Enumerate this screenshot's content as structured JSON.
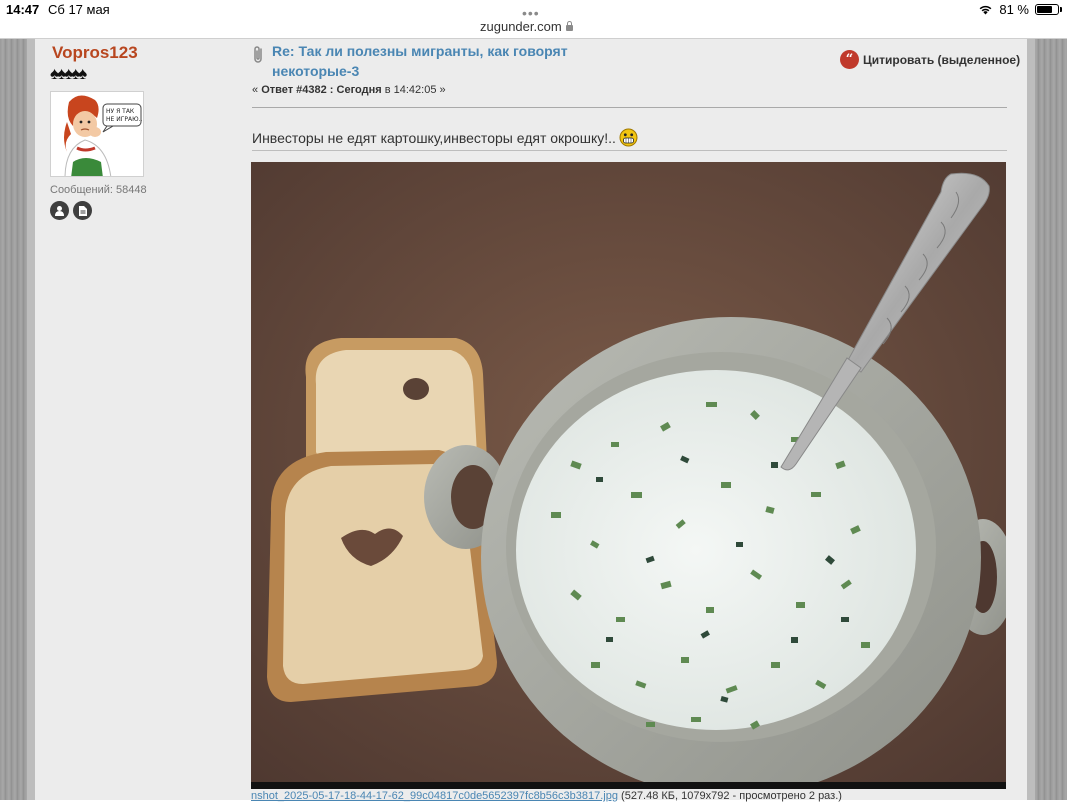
{
  "status_bar": {
    "time": "14:47",
    "date": "Сб 17 мая",
    "battery_percent": "81 %",
    "battery_level": 0.81
  },
  "browser": {
    "url": "zugunder.com"
  },
  "poster": {
    "username": "Vopros123",
    "rank_stars": "♠♠♠♠♠",
    "avatar_text": "НУ Я ТАК НЕ ИГРАЮ...",
    "posts_count": "Сообщений: 58448"
  },
  "post": {
    "title": "Re: Так ли полезны мигранты, как говорят некоторые-3",
    "meta_prefix": "« ",
    "reply_label": "Ответ #4382 : Сегодня",
    "meta_time": " в 14:42:05 »",
    "quote_label": "Цитировать (выделенное)",
    "message": "Инвесторы не едят картошку,инвесторы едят окрошку!..",
    "attachment": {
      "filename": "nshot_2025-05-17-18-44-17-62_99c04817c0de5652397fc8b56c3b3817.jpg",
      "info": " (527.48 КБ, 1079x792 - просмотрено 2 раз.)"
    }
  },
  "colors": {
    "username": "#b8461f",
    "link": "#4a86b3",
    "quote_icon": "#c0392b"
  }
}
